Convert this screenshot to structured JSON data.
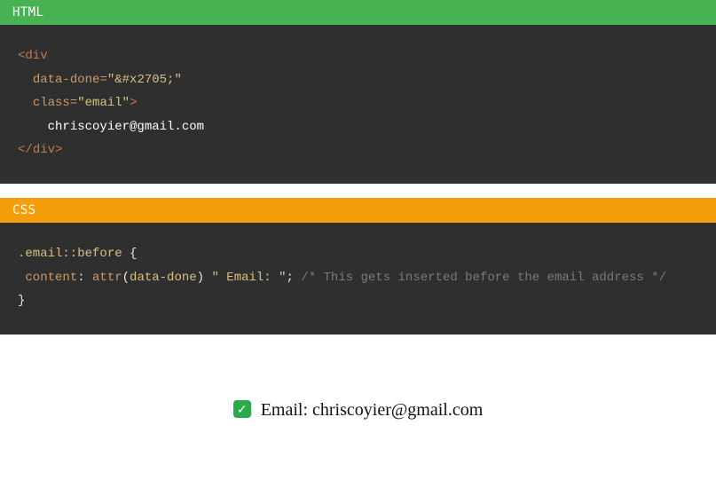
{
  "html_panel": {
    "label": "HTML",
    "code": {
      "open_tag": "div",
      "attr1_name": "data-done",
      "attr1_value": "\"&#x2705;\"",
      "attr2_name": "class",
      "attr2_value": "\"email\"",
      "content": "chriscoyier@gmail.com",
      "close_tag": "div"
    }
  },
  "css_panel": {
    "label": "CSS",
    "code": {
      "selector": ".email::before",
      "open_brace": "{",
      "prop_name": "content",
      "colon": ":",
      "func_name": "attr",
      "open_paren": "(",
      "func_arg": "data-done",
      "close_paren": ")",
      "string_literal": "\" Email: \"",
      "semicolon": ";",
      "comment": "/* This gets inserted before the email address */",
      "close_brace": "}"
    }
  },
  "preview": {
    "checkmark": "✓",
    "text": " Email: chriscoyier@gmail.com"
  }
}
